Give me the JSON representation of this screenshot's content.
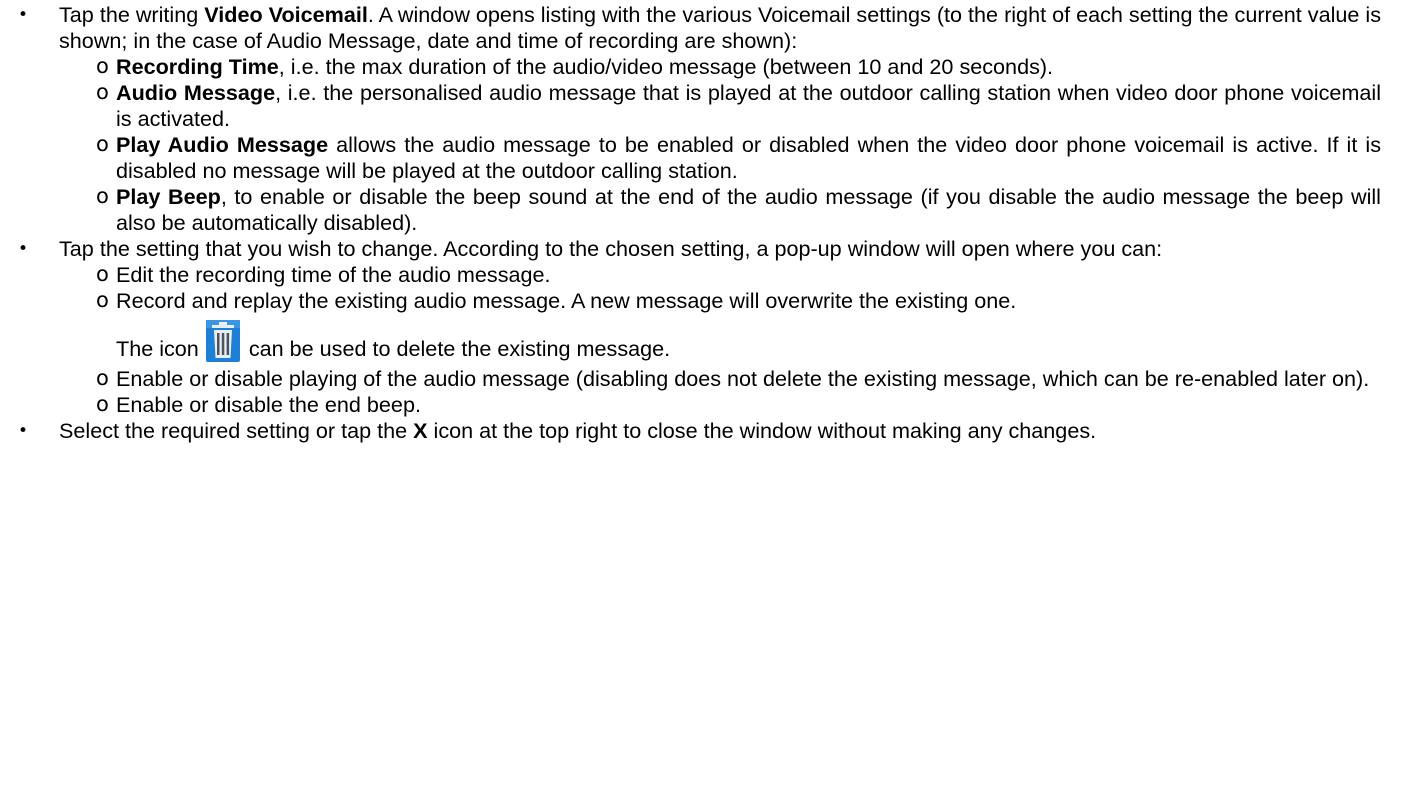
{
  "items": [
    {
      "pre": "Tap the writing ",
      "bold": "Video Voicemail",
      "post": ". A window opens listing with the various Voicemail settings (to the right of each setting the current value is shown; in the case of Audio Message, date and time of recording are shown):",
      "subitems": [
        {
          "bold": "Recording Time",
          "post": ", i.e. the max duration of the audio/video message (between 10 and 20 seconds)."
        },
        {
          "bold": "Audio Message",
          "post": ", i.e. the personalised audio message that is played at the outdoor calling station when video door phone voicemail is activated."
        },
        {
          "bold": "Play Audio Message",
          "post": " allows the audio message to be enabled or disabled when the video door phone voicemail is active. If it is disabled no message will be played at the outdoor calling station."
        },
        {
          "bold": "Play Beep",
          "post": ", to enable or disable the beep sound at the end of the audio message (if you disable the audio message the beep will also be automatically disabled)."
        }
      ]
    },
    {
      "text": "Tap the setting that you wish to change. According to the chosen setting, a pop-up window will open where you can:",
      "subitems": [
        {
          "text": "Edit the recording time of the audio message."
        },
        {
          "text": "Record and replay the existing audio message. A new message will overwrite the existing one.",
          "icon_pre": "The icon",
          "icon_name": "trash-icon",
          "icon_post": "can be used to delete the existing message."
        },
        {
          "text": "Enable or disable playing of the audio message (disabling does not delete the existing message, which can be re-enabled later on)."
        },
        {
          "text": "Enable or disable the end beep."
        }
      ]
    },
    {
      "pre": "Select the required setting or tap the ",
      "bold": "X",
      "post": " icon at the top right to close the window without making any changes."
    }
  ],
  "bullets": {
    "level1": "•",
    "level2": "o"
  },
  "colors": {
    "text": "#000000",
    "icon_blue": "#1e7fd6",
    "icon_bin": "#e8eef3"
  }
}
